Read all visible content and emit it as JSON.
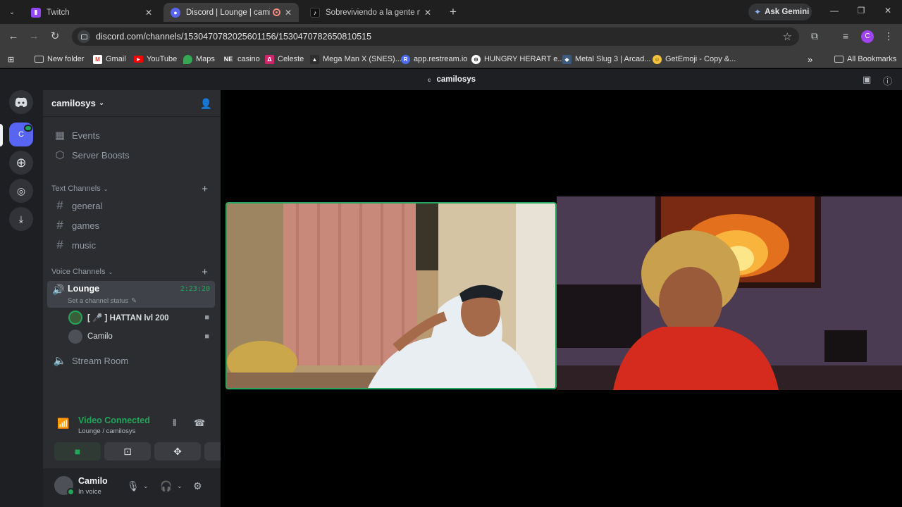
{
  "browser": {
    "tabs": [
      {
        "title": "Twitch",
        "favicon": "twitch-icon",
        "color": "#9146ff"
      },
      {
        "title": "Discord | Lounge | camilosys",
        "favicon": "discord-icon",
        "color": "#5865f2",
        "active": true,
        "recording": true
      },
      {
        "title": "Sobreviviendo a la gente más tó",
        "favicon": "tiktok-icon",
        "color": "#111111"
      }
    ],
    "new_tab": "+",
    "gemini_label": "Ask Gemini",
    "url": "discord.com/channels/1530470782025601156/1530470782650810515",
    "profile_initial": "C",
    "bookmarks": [
      {
        "label": "New folder",
        "icon": "folder-icon"
      },
      {
        "label": "Gmail",
        "icon": "gmail-icon"
      },
      {
        "label": "YouTube",
        "icon": "youtube-icon"
      },
      {
        "label": "Maps",
        "icon": "maps-icon"
      },
      {
        "label": "casino",
        "icon": "ne-icon",
        "badge": "NE"
      },
      {
        "label": "Celeste",
        "icon": "celeste-icon"
      },
      {
        "label": "Mega Man X (SNES)...",
        "icon": "megaman-icon"
      },
      {
        "label": "app.restream.io",
        "icon": "restream-icon",
        "badge": "R"
      },
      {
        "label": "HUNGRY HERART e...",
        "icon": "hungry-icon"
      },
      {
        "label": "Metal Slug 3 | Arcad...",
        "icon": "metalslug-icon"
      },
      {
        "label": "GetEmoji - Copy &...",
        "icon": "emoji-icon"
      }
    ],
    "bookmarks_overflow": "»",
    "all_bookmarks": "All Bookmarks"
  },
  "discord": {
    "window_title": "camilosys",
    "window_title_prefix": "c",
    "server_icon_initial": "C",
    "server_name": "camilosys",
    "menu": [
      {
        "label": "Events",
        "icon": "calendar-icon"
      },
      {
        "label": "Server Boosts",
        "icon": "boost-icon"
      }
    ],
    "text_category": "Text Channels",
    "text_channels": [
      "general",
      "games",
      "music"
    ],
    "voice_category": "Voice Channels",
    "active_voice": {
      "name": "Lounge",
      "timer": "2:23:20",
      "status_hint": "Set a channel status"
    },
    "voice_users": [
      {
        "name": "[ 🎤 ] HATTAN lvl 200",
        "avatar_color": "#3b5e3a",
        "bold": true
      },
      {
        "name": "Camilo",
        "avatar_color": "#4e5058",
        "bold": false
      }
    ],
    "other_voice": "Stream Room",
    "voice_panel": {
      "title": "Video Connected",
      "subtitle": "Lounge / camilosys"
    },
    "user": {
      "name": "Camilo",
      "status": "In voice"
    },
    "colors": {
      "green": "#23a55a",
      "blurple": "#5865f2"
    }
  }
}
